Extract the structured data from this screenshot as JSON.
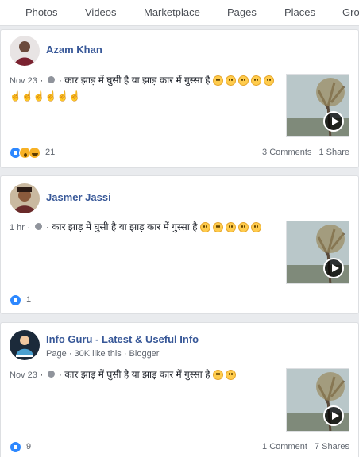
{
  "nav": {
    "tabs": [
      "Photos",
      "Videos",
      "Marketplace",
      "Pages",
      "Places",
      "Gro"
    ]
  },
  "posts": [
    {
      "author": "Azam Khan",
      "time": "Nov 23",
      "text": "कार झाड़ में घुसी है या झाड़ कार में गुस्सा है",
      "emoji_pattern": [
        "smile",
        "smile",
        "smile",
        "smile",
        "smile",
        "hand",
        "hand",
        "hand",
        "hand",
        "hand",
        "hand"
      ],
      "reaction_count": "21",
      "comments": "3 Comments",
      "shares": "1 Share"
    },
    {
      "author": "Jasmer Jassi",
      "time": "1 hr",
      "text": "कार झाड़ में घुसी है या झाड़ कार में गुस्सा है",
      "reaction_count": "1"
    },
    {
      "author": "Info Guru - Latest & Useful Info",
      "subline": "Page · 30K like this · Blogger",
      "time": "Nov 23",
      "text": "कार झाड़ में घुसी है या झाड़ कार में गुस्सा है",
      "reaction_count": "9",
      "comments": "1 Comment",
      "shares": "7 Shares"
    }
  ],
  "colors": {
    "link": "#385898",
    "like": "#2d88ff",
    "page_bg": "#e9ebee"
  }
}
